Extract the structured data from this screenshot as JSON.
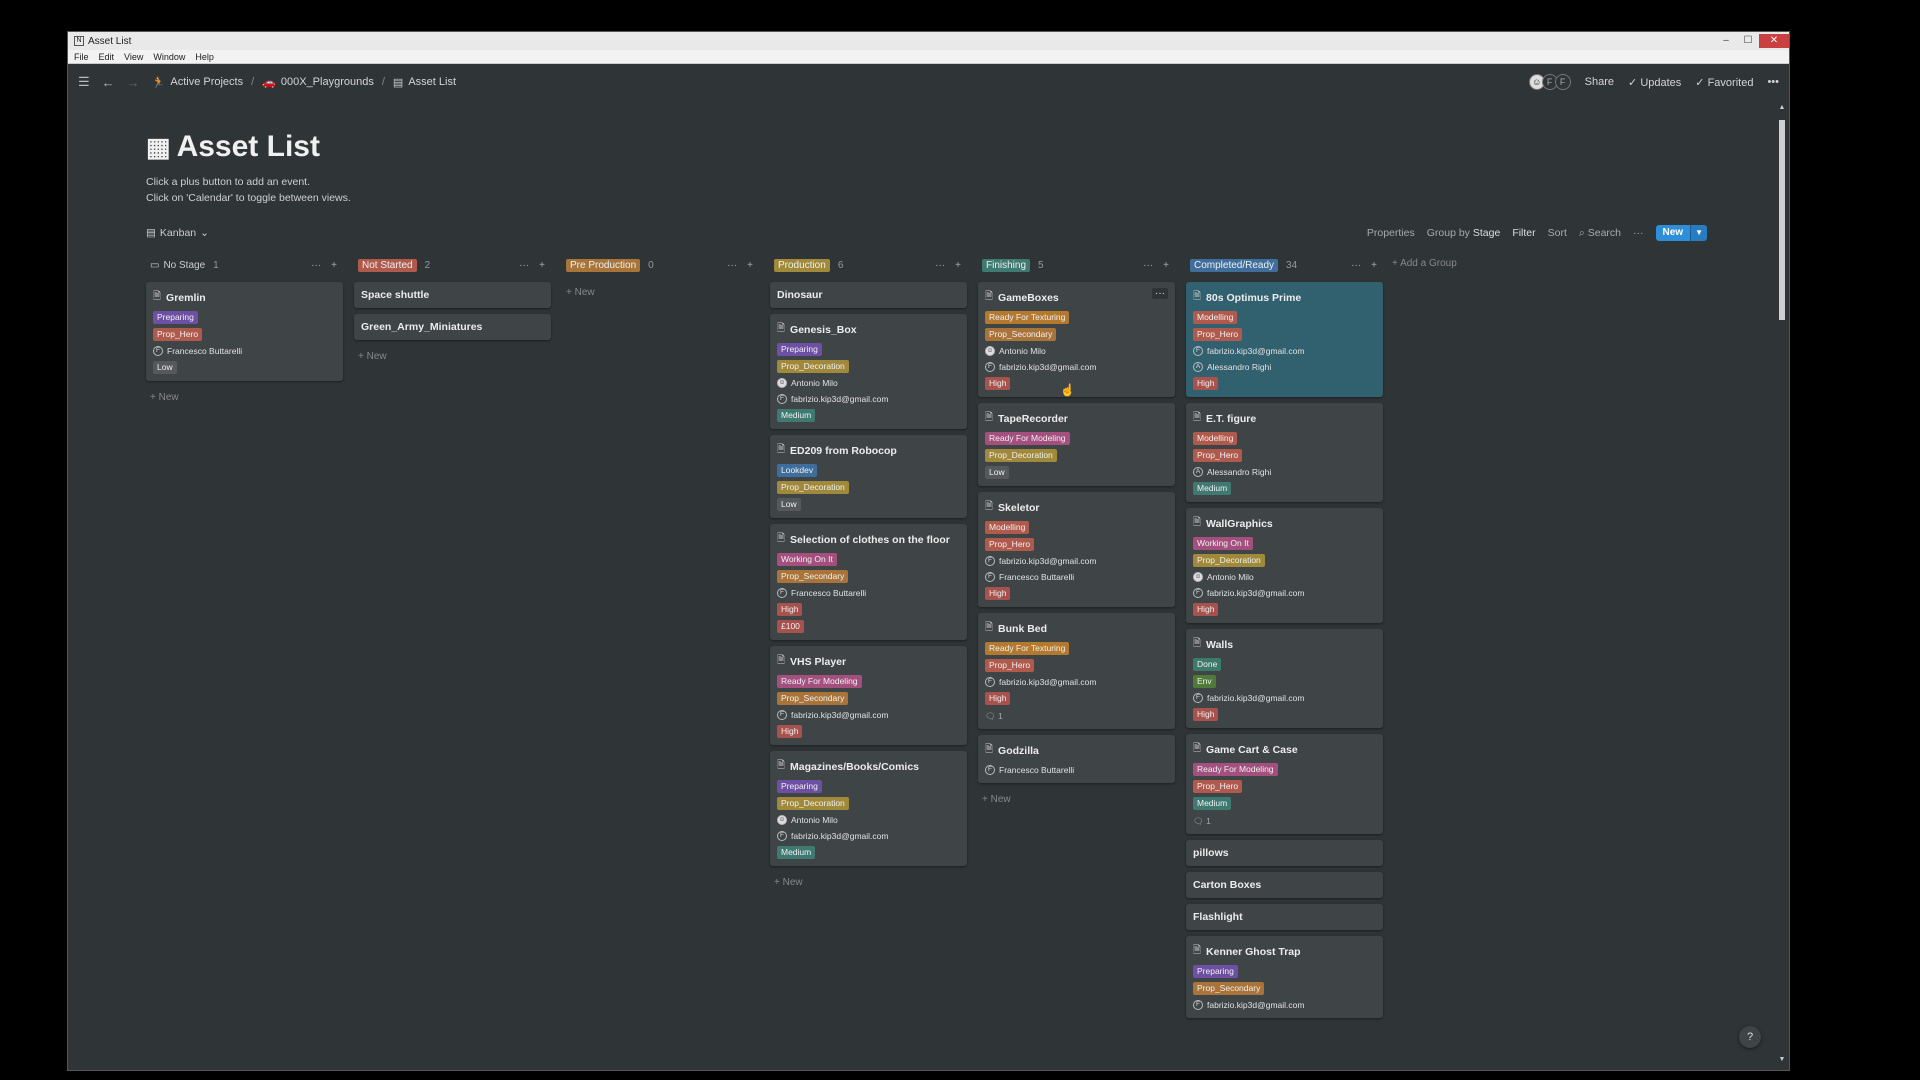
{
  "window": {
    "title": "Asset List",
    "controls": [
      "–",
      "☐",
      "✕"
    ]
  },
  "menu": [
    "File",
    "Edit",
    "View",
    "Window",
    "Help"
  ],
  "breadcrumb": [
    {
      "icon": "🏃",
      "label": "Active Projects"
    },
    {
      "icon": "🚗",
      "label": "000X_Playgrounds"
    },
    {
      "icon": "▤",
      "label": "Asset List"
    }
  ],
  "topright": {
    "avatars": [
      "",
      "F",
      "F"
    ],
    "share": "Share",
    "updates": "Updates",
    "favorited": "Favorited",
    "more": "•••"
  },
  "page": {
    "title": "Asset List",
    "desc": [
      "Click a plus button to add an event.",
      "Click on 'Calendar' to toggle between views."
    ]
  },
  "viewbar": {
    "view": "Kanban",
    "properties": "Properties",
    "group_by": "Group by",
    "group_by_value": "Stage",
    "filter": "Filter",
    "sort": "Sort",
    "search": "Search",
    "more": "···",
    "new": "New"
  },
  "colors": {
    "Preparing": "#6d4fa3",
    "Prop_Hero": "#b05a4e",
    "Ready For Texturing": "#b3792f",
    "Prop_Secondary": "#a8743a",
    "Prop_Decoration": "#a0893a",
    "Ready For Modeling": "#a4507f",
    "Modelling": "#b05a4e",
    "Working On It": "#a4507f",
    "Lookdev": "#3f6e9c",
    "Done": "#3c7a6a",
    "Env": "#4f7a3a",
    "High": "#a8524e",
    "Medium": "#3e7a72",
    "Low": "#55595c",
    "£100": "#a8524e"
  },
  "columns": [
    {
      "name": "No Stage",
      "count": "1",
      "color": "",
      "icon": "▭",
      "cards": [
        {
          "title": "Gremlin",
          "doc": true,
          "tags": [
            "Preparing",
            "Prop_Hero"
          ],
          "people": [
            {
              "i": "F",
              "name": "Francesco Buttarelli"
            }
          ],
          "tags2": [
            "Low"
          ]
        }
      ],
      "add": "New"
    },
    {
      "name": "Not Started",
      "count": "2",
      "color": "#b05a4e",
      "icon": "",
      "cards": [
        {
          "title": "Space shuttle",
          "doc": false
        },
        {
          "title": "Green_Army_Miniatures",
          "doc": false
        }
      ],
      "add": "New"
    },
    {
      "name": "Pre Production",
      "count": "0",
      "color": "#a8743a",
      "icon": "",
      "cards": [],
      "add": "New"
    },
    {
      "name": "Production",
      "count": "6",
      "color": "#a0893a",
      "icon": "",
      "cards": [
        {
          "title": "Dinosaur",
          "doc": false
        },
        {
          "title": "Genesis_Box",
          "doc": true,
          "tags": [
            "Preparing",
            "Prop_Decoration"
          ],
          "people": [
            {
              "i": "ph",
              "name": "Antonio Milo"
            },
            {
              "i": "F",
              "name": "fabrizio.kip3d@gmail.com"
            }
          ],
          "tags2": [
            "Medium"
          ]
        },
        {
          "title": "ED209 from Robocop",
          "doc": true,
          "tags": [
            "Lookdev",
            "Prop_Decoration"
          ],
          "tags2": [
            "Low"
          ]
        },
        {
          "title": "Selection of clothes on the floor",
          "doc": true,
          "tags": [
            "Working On It",
            "Prop_Secondary"
          ],
          "people": [
            {
              "i": "F",
              "name": "Francesco Buttarelli"
            }
          ],
          "tags2": [
            "High",
            "£100"
          ]
        },
        {
          "title": "VHS Player",
          "doc": true,
          "tags": [
            "Ready For Modeling",
            "Prop_Secondary"
          ],
          "people": [
            {
              "i": "F",
              "name": "fabrizio.kip3d@gmail.com"
            }
          ],
          "tags2": [
            "High"
          ]
        },
        {
          "title": "Magazines/Books/Comics",
          "doc": true,
          "tags": [
            "Preparing",
            "Prop_Decoration"
          ],
          "people": [
            {
              "i": "ph",
              "name": "Antonio Milo"
            },
            {
              "i": "F",
              "name": "fabrizio.kip3d@gmail.com"
            }
          ],
          "tags2": [
            "Medium"
          ]
        }
      ],
      "add": "New"
    },
    {
      "name": "Finishing",
      "count": "5",
      "color": "#3e7a72",
      "icon": "",
      "cards": [
        {
          "title": "GameBoxes",
          "doc": true,
          "dots": true,
          "tags": [
            "Ready For Texturing",
            "Prop_Secondary"
          ],
          "people": [
            {
              "i": "ph",
              "name": "Antonio Milo"
            },
            {
              "i": "F",
              "name": "fabrizio.kip3d@gmail.com"
            }
          ],
          "tags2": [
            "High"
          ]
        },
        {
          "title": "TapeRecorder",
          "doc": true,
          "tags": [
            "Ready For Modeling",
            "Prop_Decoration"
          ],
          "tags2": [
            "Low"
          ]
        },
        {
          "title": "Skeletor",
          "doc": true,
          "tags": [
            "Modelling",
            "Prop_Hero"
          ],
          "people": [
            {
              "i": "F",
              "name": "fabrizio.kip3d@gmail.com"
            },
            {
              "i": "F",
              "name": "Francesco Buttarelli"
            }
          ],
          "tags2": [
            "High"
          ]
        },
        {
          "title": "Bunk Bed",
          "doc": true,
          "tags": [
            "Ready For Texturing",
            "Prop_Hero"
          ],
          "people": [
            {
              "i": "F",
              "name": "fabrizio.kip3d@gmail.com"
            }
          ],
          "tags2": [
            "High"
          ],
          "comments": "1"
        },
        {
          "title": "Godzilla",
          "doc": true,
          "people": [
            {
              "i": "F",
              "name": "Francesco Buttarelli"
            }
          ]
        }
      ],
      "add": "New"
    },
    {
      "name": "Completed/Ready",
      "count": "34",
      "color": "#3f6e9c",
      "icon": "",
      "cards": [
        {
          "title": "80s Optimus Prime",
          "doc": true,
          "highlight": true,
          "tags": [
            "Modelling",
            "Prop_Hero"
          ],
          "people": [
            {
              "i": "F",
              "name": "fabrizio.kip3d@gmail.com"
            },
            {
              "i": "A",
              "name": "Alessandro Righi"
            }
          ],
          "tags2": [
            "High"
          ]
        },
        {
          "title": "E.T. figure",
          "doc": true,
          "tags": [
            "Modelling",
            "Prop_Hero"
          ],
          "people": [
            {
              "i": "A",
              "name": "Alessandro Righi"
            }
          ],
          "tags2": [
            "Medium"
          ]
        },
        {
          "title": "WallGraphics",
          "doc": true,
          "tags": [
            "Working On It",
            "Prop_Decoration"
          ],
          "people": [
            {
              "i": "ph",
              "name": "Antonio Milo"
            },
            {
              "i": "F",
              "name": "fabrizio.kip3d@gmail.com"
            }
          ],
          "tags2": [
            "High"
          ]
        },
        {
          "title": "Walls",
          "doc": true,
          "tags": [
            "Done",
            "Env"
          ],
          "people": [
            {
              "i": "F",
              "name": "fabrizio.kip3d@gmail.com"
            }
          ],
          "tags2": [
            "High"
          ]
        },
        {
          "title": "Game Cart & Case",
          "doc": true,
          "tags": [
            "Ready For Modeling",
            "Prop_Hero"
          ],
          "tags2": [
            "Medium"
          ],
          "comments": "1"
        },
        {
          "title": "pillows",
          "doc": false
        },
        {
          "title": "Carton Boxes",
          "doc": false
        },
        {
          "title": "Flashlight",
          "doc": false
        },
        {
          "title": "Kenner Ghost Trap",
          "doc": true,
          "tags": [
            "Preparing",
            "Prop_Secondary"
          ],
          "people": [
            {
              "i": "F",
              "name": "fabrizio.kip3d@gmail.com"
            }
          ]
        }
      ],
      "add": ""
    }
  ],
  "add_group": "Add a Group",
  "help": "?"
}
